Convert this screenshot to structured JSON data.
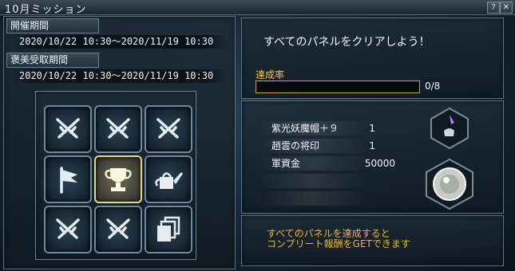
{
  "window": {
    "title": "10月ミッション",
    "help_label": "?",
    "close_label": "✕"
  },
  "period": {
    "label": "開催期間",
    "dates": "2020/10/22 10:30〜2020/11/19 10:30"
  },
  "reward_period": {
    "label": "褒美受取期間",
    "dates": "2020/10/22 10:30〜2020/11/19 10:30"
  },
  "panels": [
    {
      "icon": "crossed-swords-icon"
    },
    {
      "icon": "crossed-swords-icon"
    },
    {
      "icon": "crossed-swords-icon"
    },
    {
      "icon": "flag-icon"
    },
    {
      "icon": "trophy-icon",
      "highlighted": true
    },
    {
      "icon": "watering-can-icon"
    },
    {
      "icon": "crossed-swords-icon"
    },
    {
      "icon": "crossed-swords-icon"
    },
    {
      "icon": "stacked-cards-icon"
    }
  ],
  "mission": {
    "description": "すべてのパネルをクリアしよう！"
  },
  "progress": {
    "label": "達成率",
    "text": "0/8",
    "fraction": 0
  },
  "rewards": [
    {
      "name": "紫光妖魔帽＋９",
      "qty": "1"
    },
    {
      "name": "趙雲の将印",
      "qty": "1"
    },
    {
      "name": "軍資金",
      "qty": "50000"
    }
  ],
  "reward_icons": [
    "purple-hat-icon",
    "silver-coin-icon"
  ],
  "complete_note": {
    "line1": "すべてのパネルを達成すると",
    "line2": "コンプリート報酬をGETできます"
  },
  "colors": {
    "accent": "#e8b33a",
    "progress_label": "#f3c06b",
    "frame": "#5d7283"
  }
}
